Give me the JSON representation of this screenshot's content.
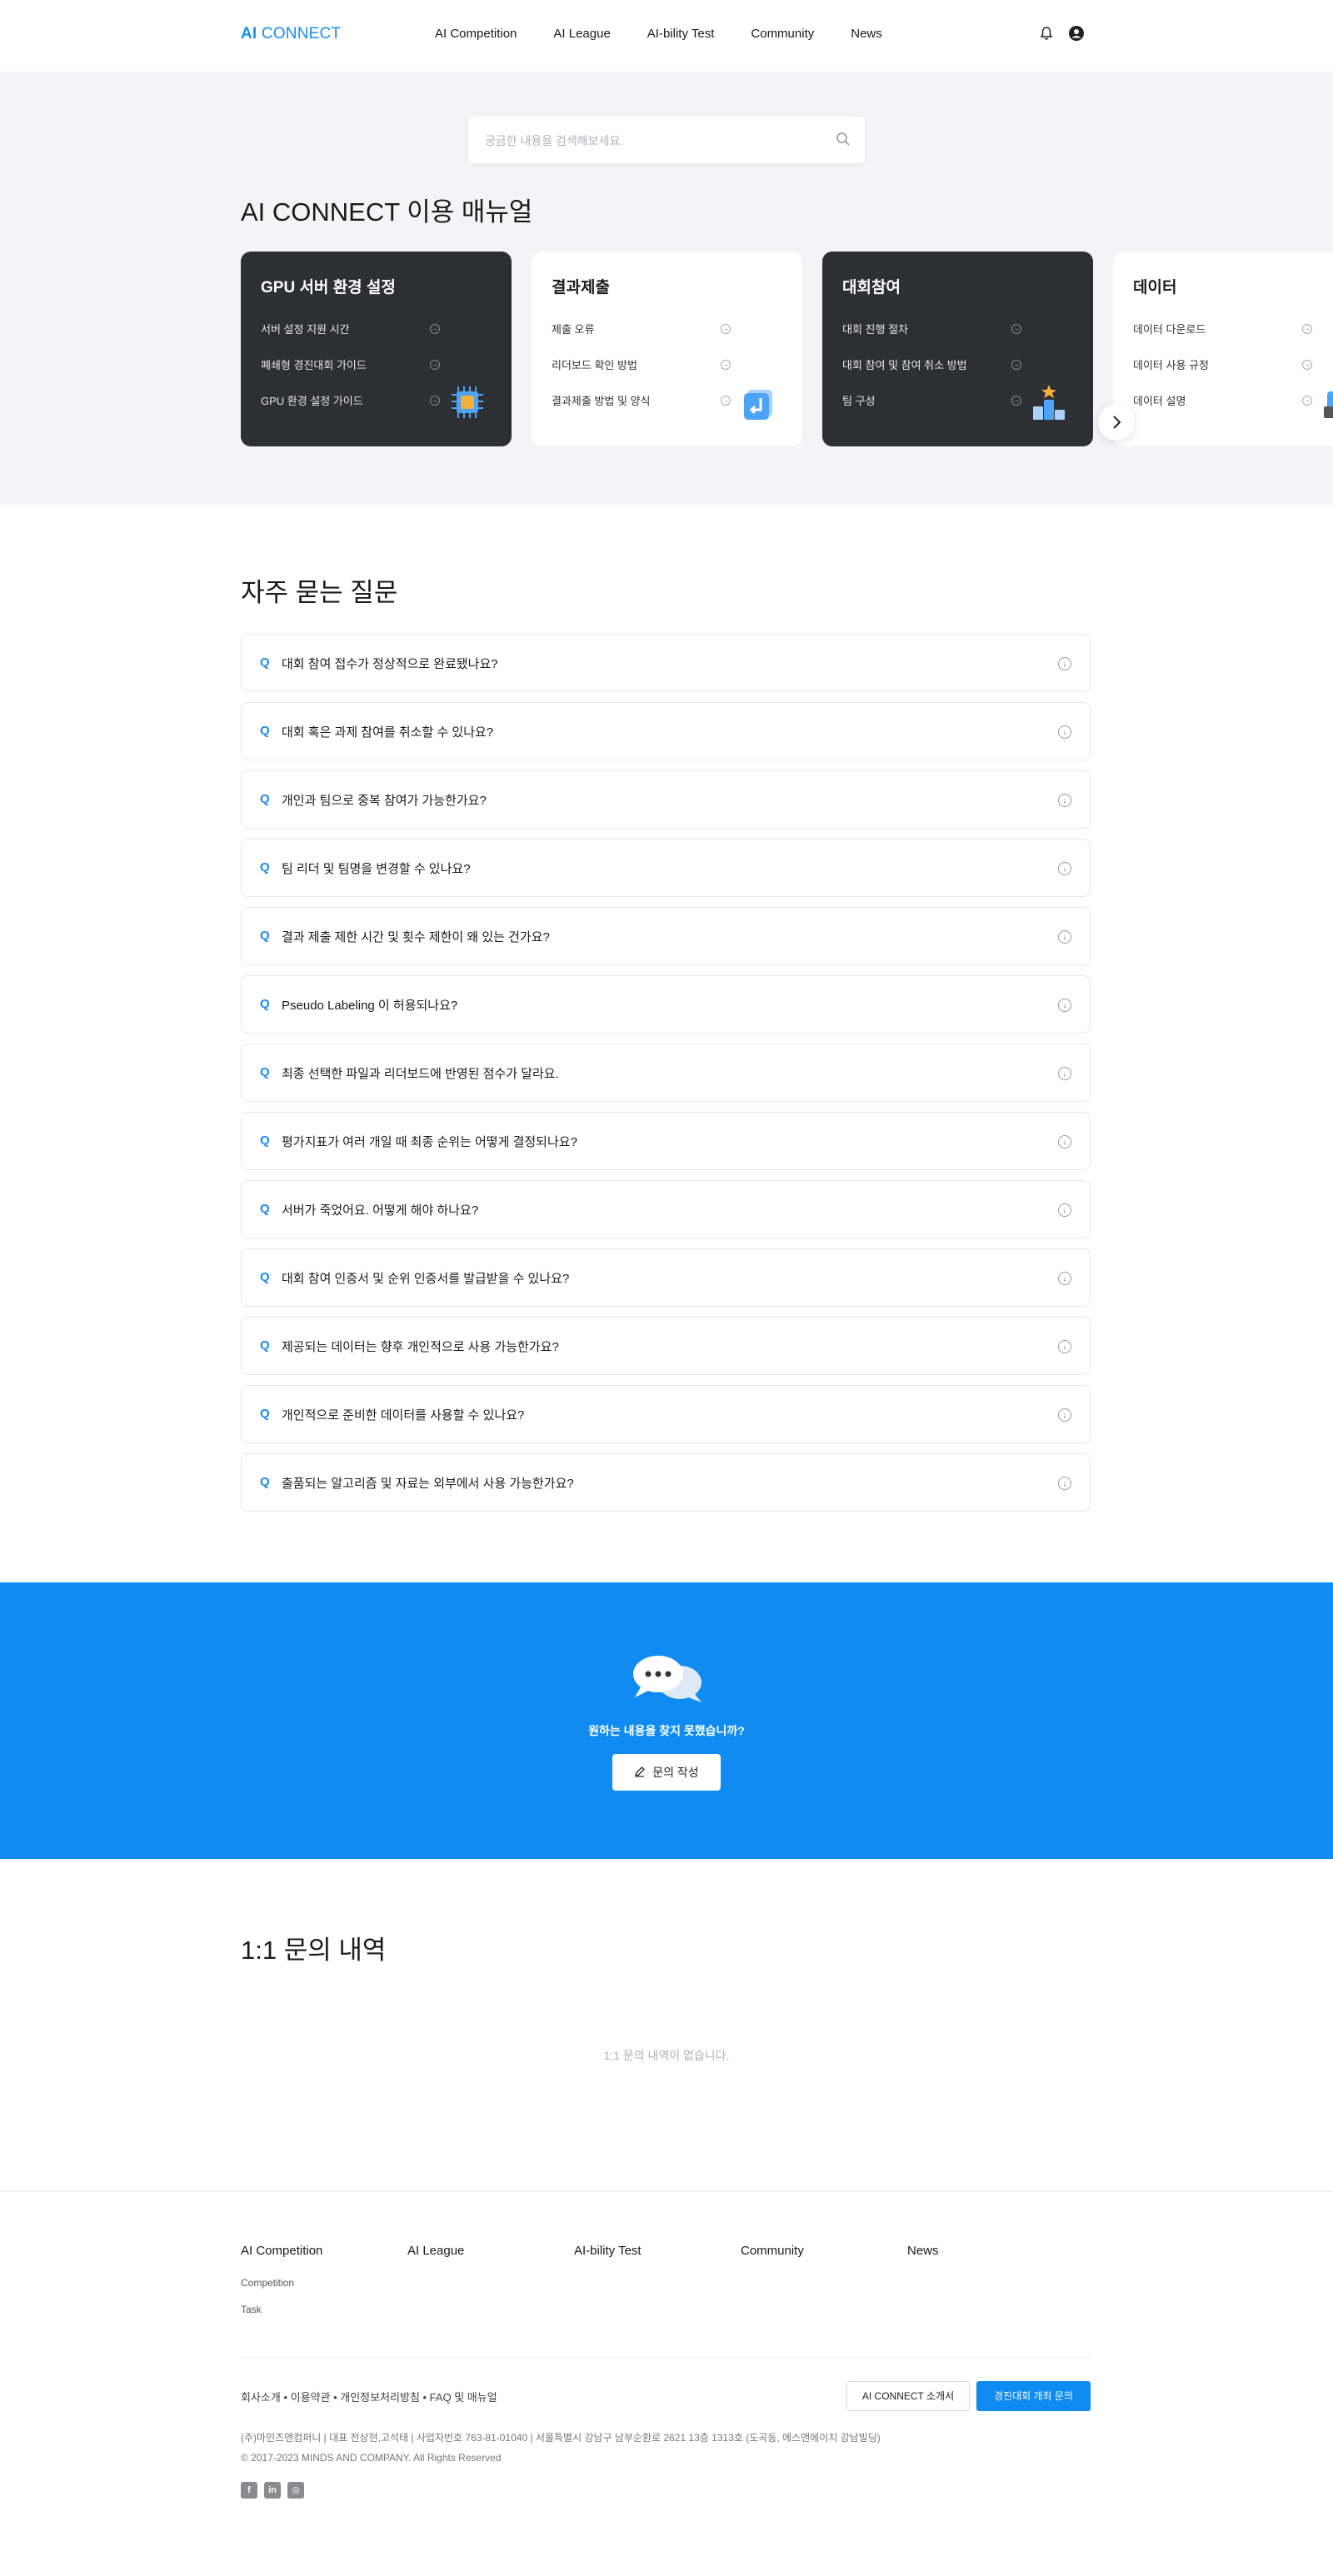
{
  "header": {
    "logo_ai": "AI",
    "logo_rest": " CONNECT",
    "nav": [
      "AI Competition",
      "AI League",
      "AI-bility Test",
      "Community",
      "News"
    ]
  },
  "search": {
    "placeholder": "궁금한 내용을 검색해보세요."
  },
  "manual": {
    "title": "AI CONNECT 이용 매뉴얼",
    "cards": [
      {
        "title": "GPU 서버 환경 설정",
        "items": [
          "서버 설정 지원 시간",
          "폐쇄형 경진대회 가이드",
          "GPU 환경 설정 가이드"
        ],
        "illustration": "gpu-chip-icon"
      },
      {
        "title": "결과제출",
        "items": [
          "제출 오류",
          "리더보드 확인 방법",
          "결과제출 방법 및 양식"
        ],
        "illustration": "submit-arrow-icon"
      },
      {
        "title": "대회참여",
        "items": [
          "대회 진행 절차",
          "대회 참여 및 참여 취소 방법",
          "팀 구성"
        ],
        "illustration": "podium-icon"
      },
      {
        "title": "데이터",
        "items": [
          "데이터 다운로드",
          "데이터 사용 규정",
          "데이터 설명"
        ],
        "illustration": "data-icon"
      }
    ]
  },
  "faq": {
    "title": "자주 묻는 질문",
    "q_marker": "Q",
    "items": [
      "대회 참여 접수가 정상적으로 완료됐나요?",
      "대회 혹은 과제 참여를 취소할 수 있나요?",
      "개인과 팀으로 중복 참여가 가능한가요?",
      "팀 리더 및 팀명을 변경할 수 있나요?",
      "결과 제출 제한 시간 및 횟수 제한이 왜 있는 건가요?",
      "Pseudo Labeling 이 허용되나요?",
      "최종 선택한 파일과 리더보드에 반영된 점수가 달라요.",
      "평가지표가 여러 개일 때 최종 순위는 어떻게 결정되나요?",
      "서버가 죽었어요. 어떻게 해야 하나요?",
      "대회 참여 인증서 및 순위 인증서를 발급받을 수 있나요?",
      "제공되는 데이터는 향후 개인적으로 사용 가능한가요?",
      "개인적으로 준비한 데이터를 사용할 수 있나요?",
      "출품되는 알고리즘 및 자료는 외부에서 사용 가능한가요?"
    ]
  },
  "cta": {
    "text": "원하는 내용을 찾지 못했습니까?",
    "button": "문의 작성"
  },
  "inquiry": {
    "title": "1:1 문의 내역",
    "empty": "1:1 문의 내역이 없습니다."
  },
  "footer": {
    "columns": [
      {
        "title": "AI Competition",
        "subs": [
          "Competition",
          "Task"
        ]
      },
      {
        "title": "AI League",
        "subs": []
      },
      {
        "title": "AI-bility Test",
        "subs": []
      },
      {
        "title": "Community",
        "subs": []
      },
      {
        "title": "News",
        "subs": []
      }
    ],
    "links": "회사소개 • 이용약관 • 개인정보처리방침 • FAQ 및 매뉴얼",
    "btn_intro": "AI CONNECT 소개서",
    "btn_host": "경진대회 개최 문의",
    "info": "(주)마인즈앤컴퍼니 | 대표 전상현,고석태 | 사업자번호 763-81-01040 | 서울특별시 강남구 남부순환로 2621 13층 1313호 (도곡동, 에스앤에이치 강남빌딩)",
    "copyright": "© 2017-2023 MINDS AND COMPANY. All Rights Reserved",
    "social": [
      "facebook-icon",
      "linkedin-icon",
      "instagram-icon"
    ]
  },
  "colors": {
    "accent": "#0f8bf1",
    "dark_card": "#2e2f33",
    "gray_bg": "#f4f4f6"
  }
}
